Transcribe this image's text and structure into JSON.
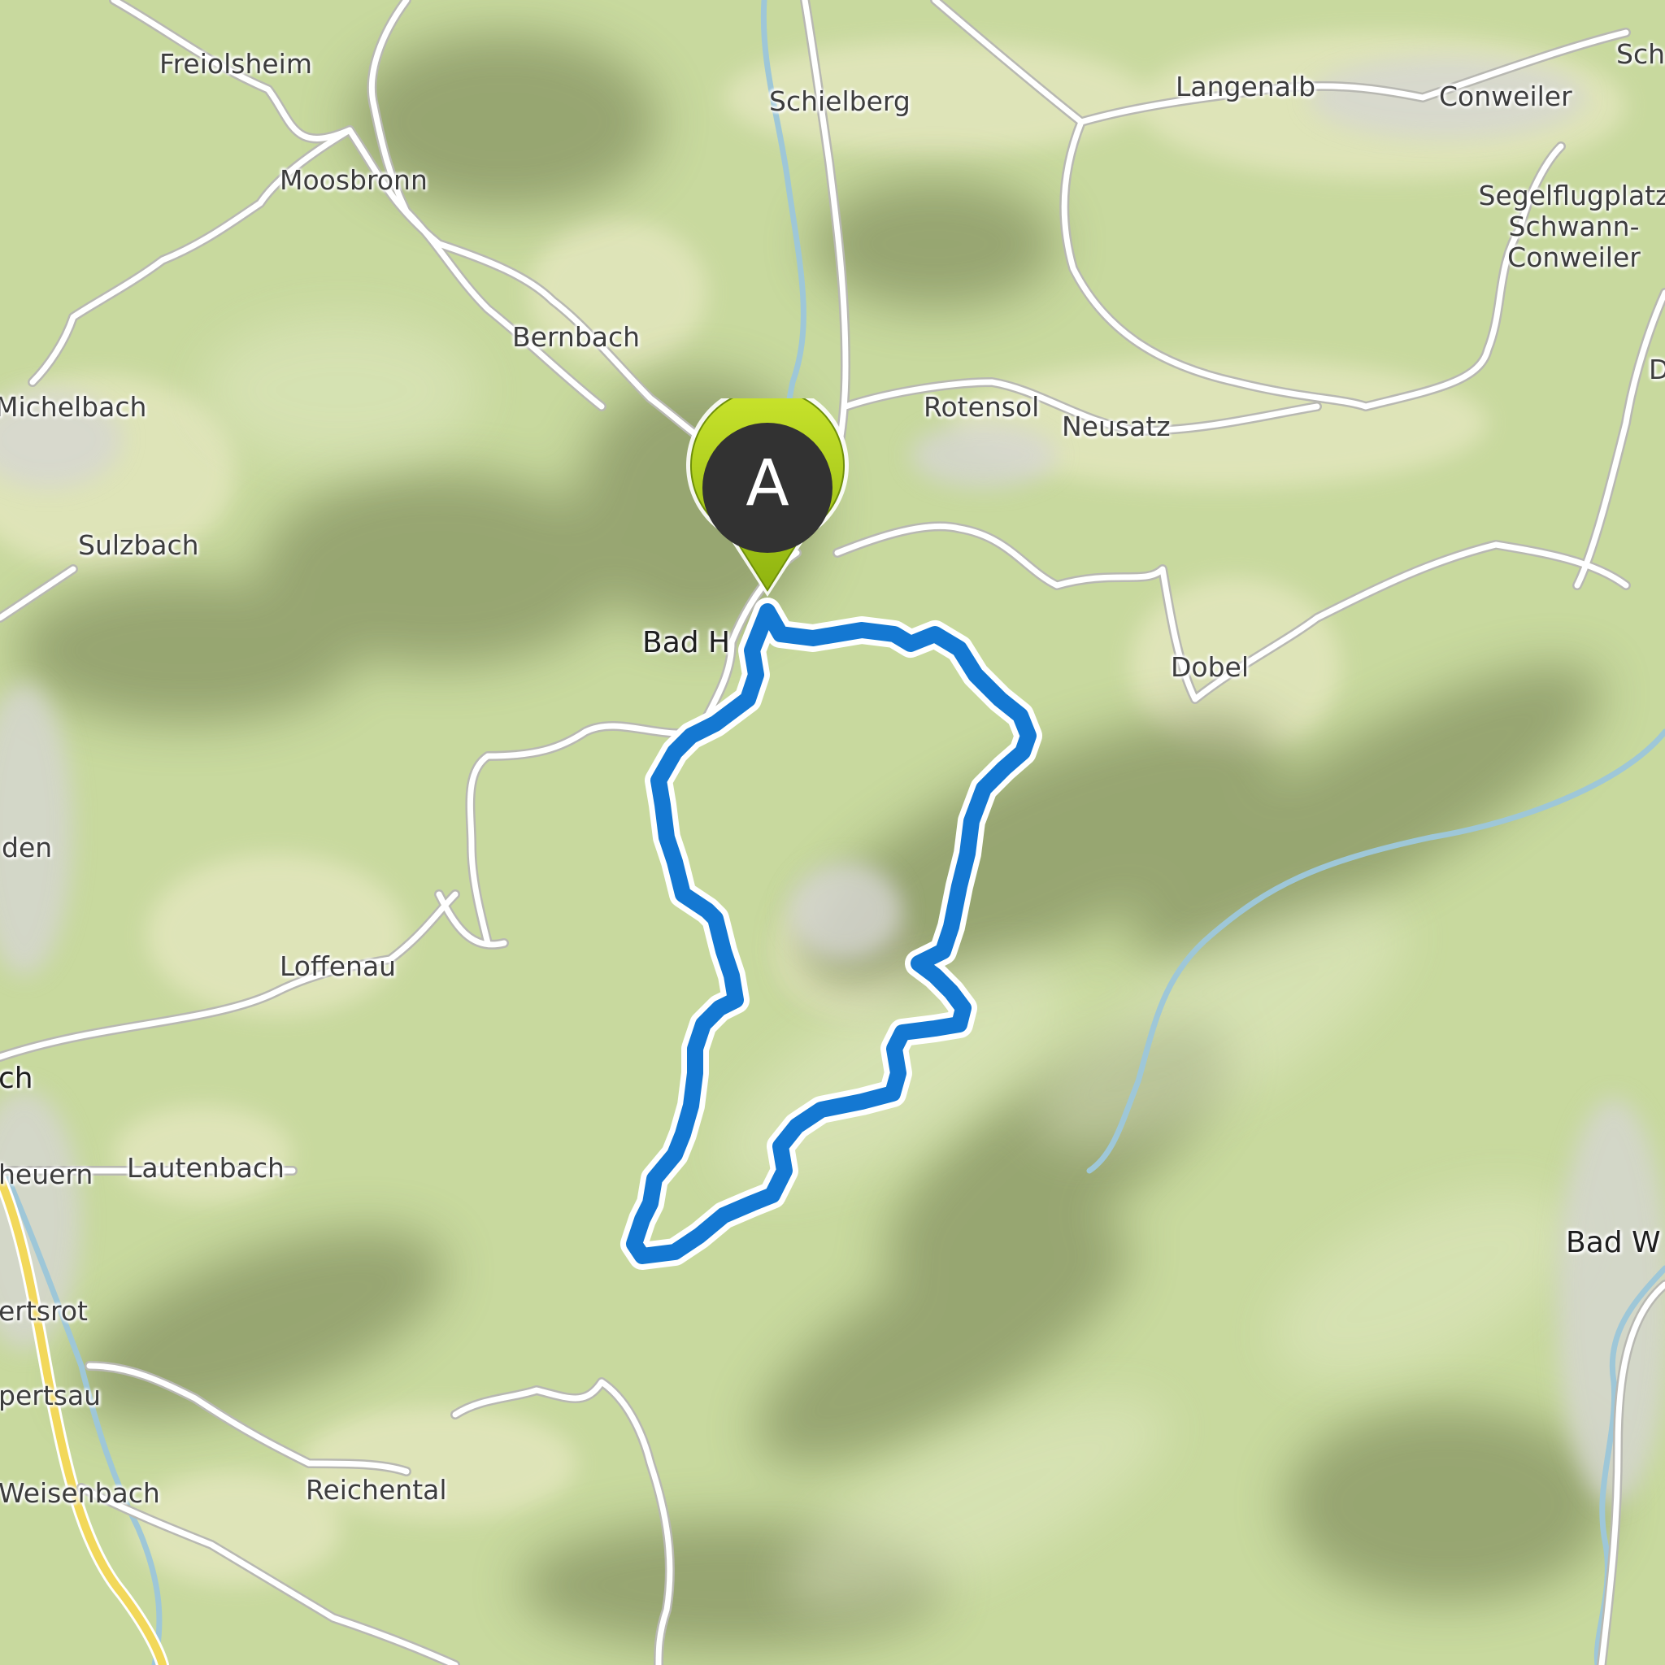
{
  "map": {
    "start_marker": {
      "letter": "A",
      "icon": "map-pin-icon",
      "color": "#a7cd1a"
    },
    "route_color": "#1478d2",
    "places": {
      "freiolsheim": "Freiolsheim",
      "moosbronn": "Moosbronn",
      "schielberg": "Schielberg",
      "langenalb": "Langenalb",
      "conweiler": "Conweiler",
      "sch": "Sch",
      "segelflugplatz": "Segelflugplatz",
      "schwann": "Schwann-",
      "conweiler2": "Conweiler",
      "bernbach": "Bernbach",
      "michelbach": "Michelbach",
      "rotensol": "Rotensol",
      "neusatz": "Neusatz",
      "d": "D",
      "sulzbach": "Sulzbach",
      "bad_h": "Bad H",
      "dobel": "Dobel",
      "den": "den",
      "loffenau": "Loffenau",
      "ch": "ch",
      "heuern": "heuern",
      "lautenbach": "Lautenbach",
      "bad_w": "Bad W",
      "ertsrot": "ertsrot",
      "pertsau": "pertsau",
      "weisenbach": "Weisenbach",
      "reichental": "Reichental"
    }
  }
}
